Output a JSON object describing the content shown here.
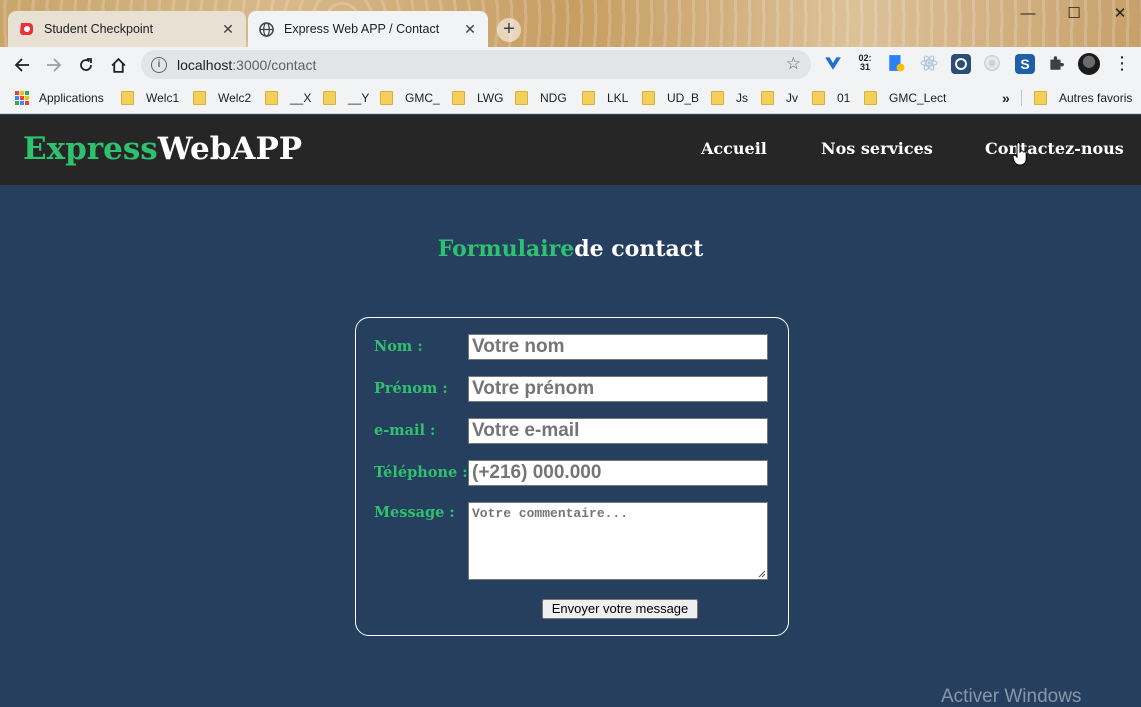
{
  "browser": {
    "tabs": [
      {
        "title": "Student Checkpoint",
        "icon": "student-checkpoint-icon"
      },
      {
        "title": "Express Web APP / Contact",
        "icon": "globe-icon"
      }
    ],
    "url_host": "localhost",
    "url_path": ":3000/contact",
    "extension_clock": "02:\n31",
    "bookmarks": [
      "Applications",
      "Welc1",
      "Welc2",
      "__X",
      "__Y",
      "GMC_",
      "LWG",
      "NDG",
      "LKL",
      "UD_B",
      "Js",
      "Jv",
      "01",
      "GMC_Lect"
    ],
    "bookmarks_overflow": "»",
    "other_bookmarks": "Autres favoris"
  },
  "site": {
    "logo_green": "Express",
    "logo_white": "WebAPP",
    "nav": [
      "Accueil",
      "Nos services",
      "Contactez-nous"
    ]
  },
  "form": {
    "title_green": "Formulaire",
    "title_white": "de contact",
    "fields": [
      {
        "label": "Nom :",
        "placeholder": "Votre nom"
      },
      {
        "label": "Prénom :",
        "placeholder": "Votre prénom"
      },
      {
        "label": "e-mail :",
        "placeholder": "Votre e-mail"
      },
      {
        "label": "Téléphone :",
        "placeholder": "(+216) 000.000"
      }
    ],
    "message_label": "Message :",
    "message_placeholder": "Votre commentaire...",
    "submit_label": "Envoyer votre message"
  },
  "os": {
    "watermark": "Activer Windows"
  },
  "colors": {
    "accent_green": "#2ec26e",
    "header_bg": "#262626",
    "page_bg": "#263f5f"
  }
}
